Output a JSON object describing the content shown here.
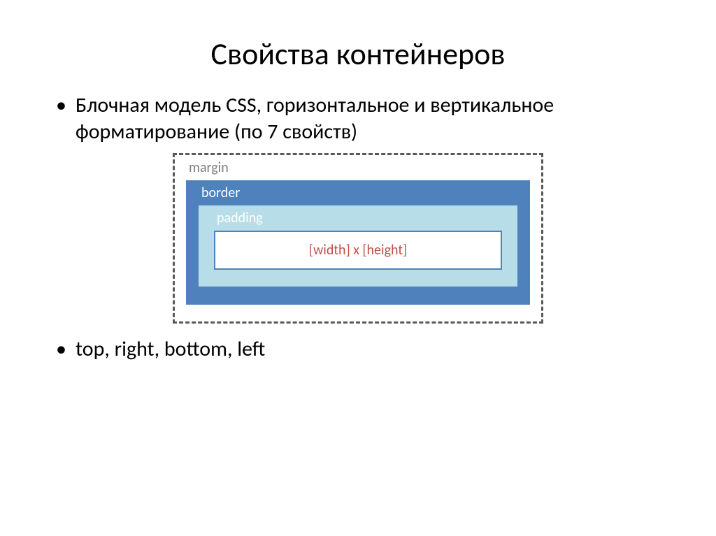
{
  "title": "Свойства контейнеров",
  "bullets": {
    "first": "Блочная модель CSS, горизонтальное и вертикальное форматирование (по 7 свойств)",
    "second": "top, right, bottom, left"
  },
  "diagram": {
    "margin_label": "margin",
    "border_label": "border",
    "padding_label": "padding",
    "content_label": "[width] x [height]"
  }
}
